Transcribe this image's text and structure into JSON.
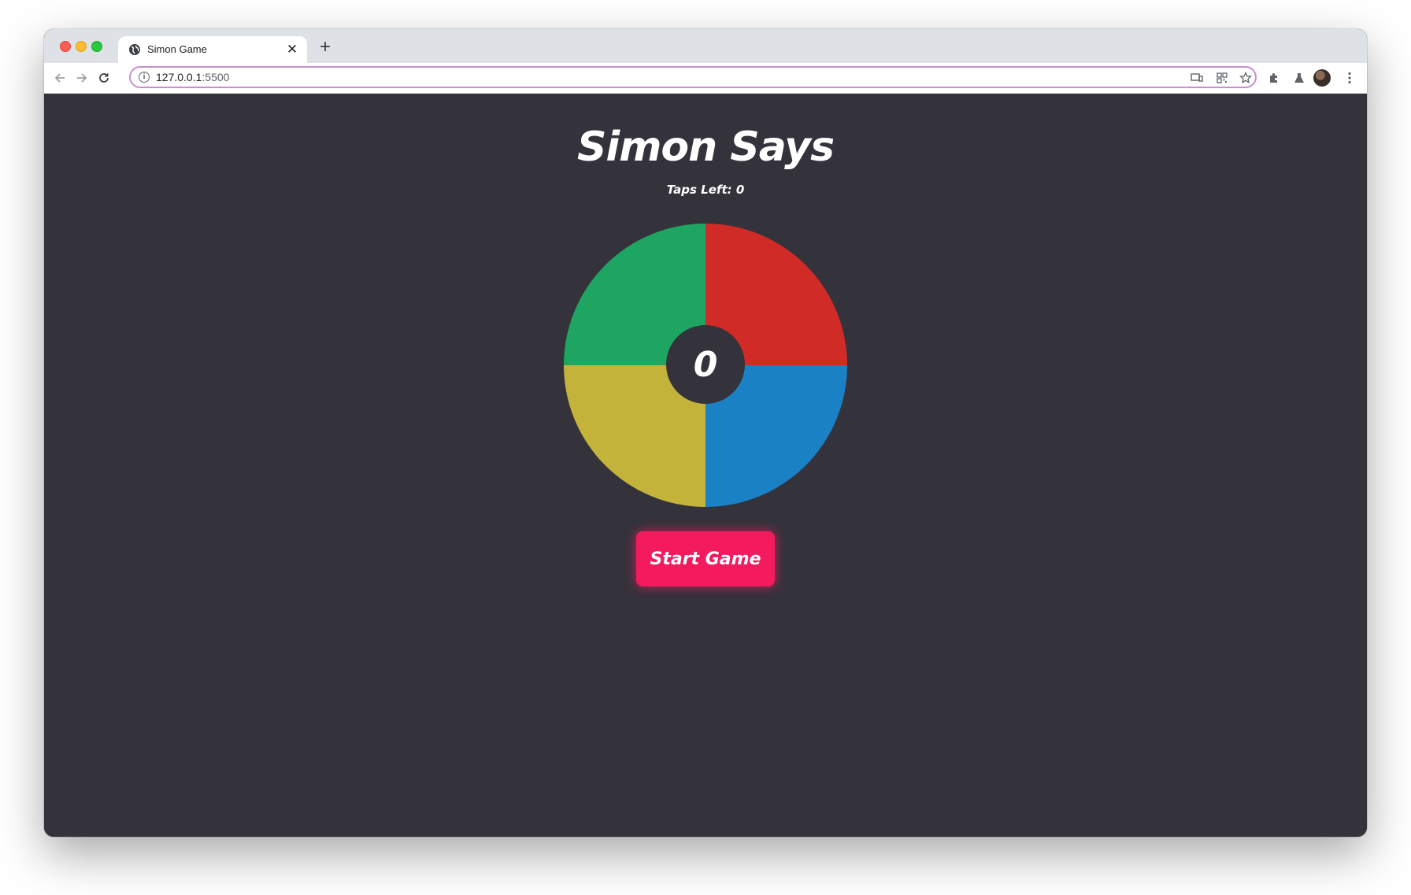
{
  "browser": {
    "tab_title": "Simon Game",
    "url_host": "127.0.0.1",
    "url_port": ":5500"
  },
  "game": {
    "title": "Simon Says",
    "taps_left": "Taps Left: 0",
    "score": "0",
    "start_label": "Start Game",
    "colors": {
      "green": "#1ea562",
      "red": "#d12b27",
      "yellow": "#c3b33b",
      "blue": "#1a81c4",
      "button": "#f31b5e",
      "background": "#34323b"
    }
  }
}
